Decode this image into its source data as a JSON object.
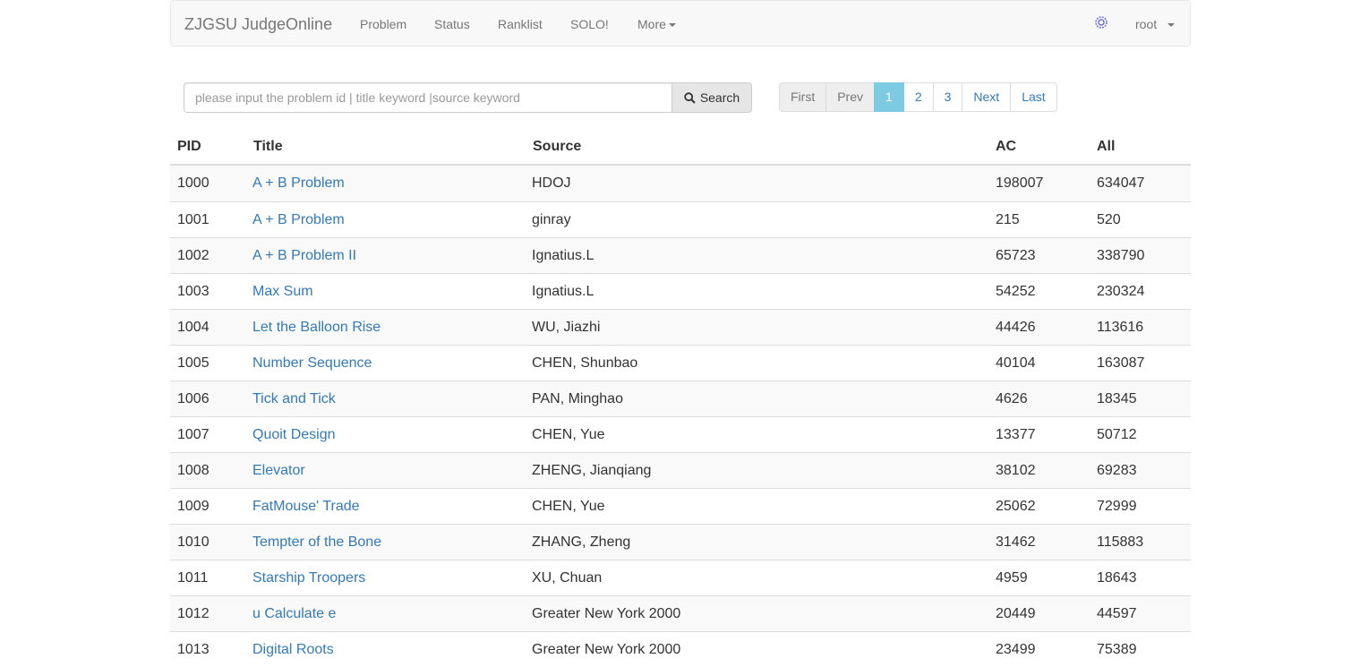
{
  "navbar": {
    "brand": "ZJGSU JudgeOnline",
    "items": [
      "Problem",
      "Status",
      "Ranklist",
      "SOLO!",
      "More"
    ],
    "user": "root"
  },
  "search": {
    "placeholder": "please input the problem id | title keyword |source keyword",
    "value": "",
    "button_label": "Search"
  },
  "pagination": {
    "first": "First",
    "prev": "Prev",
    "pages": [
      "1",
      "2",
      "3"
    ],
    "current": "1",
    "next": "Next",
    "last": "Last"
  },
  "table": {
    "headers": [
      "PID",
      "Title",
      "Source",
      "AC",
      "All"
    ],
    "rows": [
      [
        "1000",
        "A + B Problem",
        "HDOJ",
        "198007",
        "634047"
      ],
      [
        "1001",
        "A + B Problem",
        "ginray",
        "215",
        "520"
      ],
      [
        "1002",
        "A + B Problem II",
        "Ignatius.L",
        "65723",
        "338790"
      ],
      [
        "1003",
        "Max Sum",
        "Ignatius.L",
        "54252",
        "230324"
      ],
      [
        "1004",
        "Let the Balloon Rise",
        "WU, Jiazhi",
        "44426",
        "113616"
      ],
      [
        "1005",
        "Number Sequence",
        "CHEN, Shunbao",
        "40104",
        "163087"
      ],
      [
        "1006",
        "Tick and Tick",
        "PAN, Minghao",
        "4626",
        "18345"
      ],
      [
        "1007",
        "Quoit Design",
        "CHEN, Yue",
        "13377",
        "50712"
      ],
      [
        "1008",
        "Elevator",
        "ZHENG, Jianqiang",
        "38102",
        "69283"
      ],
      [
        "1009",
        "FatMouse' Trade",
        "CHEN, Yue",
        "25062",
        "72999"
      ],
      [
        "1010",
        "Tempter of the Bone",
        "ZHANG, Zheng",
        "31462",
        "115883"
      ],
      [
        "1011",
        "Starship Troopers",
        "XU, Chuan",
        "4959",
        "18643"
      ],
      [
        "1012",
        "u Calculate e",
        "Greater New York 2000",
        "20449",
        "44597"
      ],
      [
        "1013",
        "Digital Roots",
        "Greater New York 2000",
        "23499",
        "75389"
      ]
    ]
  },
  "colors": {
    "link": "#337ab7",
    "active_page": "#7ccbe3",
    "navbar_bg": "#f8f8f8"
  }
}
